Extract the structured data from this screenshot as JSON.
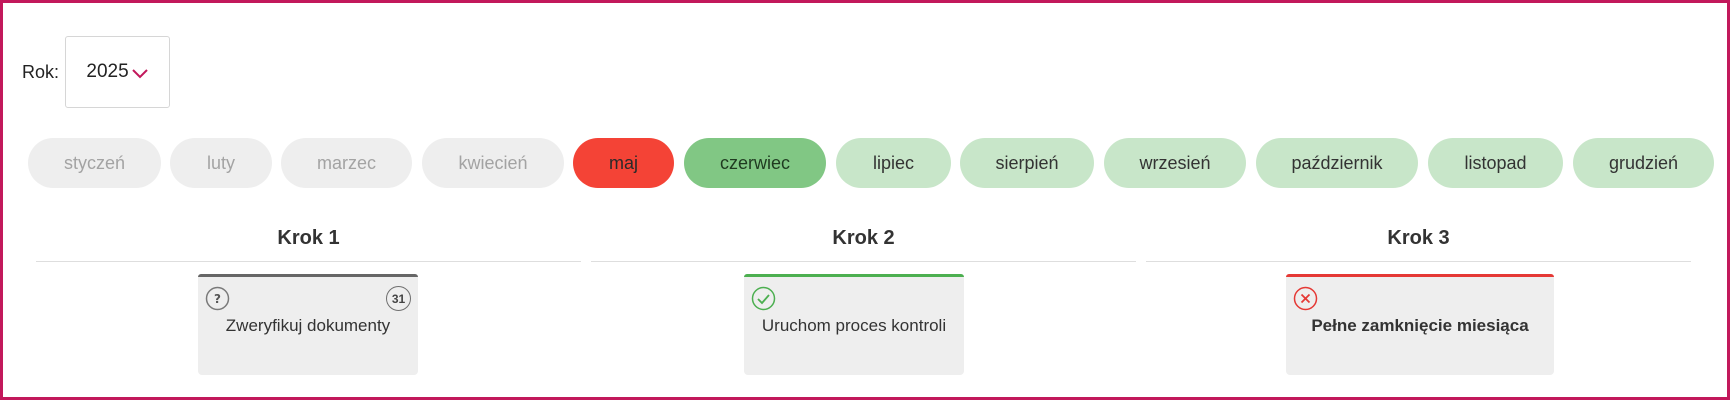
{
  "year_selector": {
    "label": "Rok:",
    "value": "2025",
    "icon": "chevron-down-icon",
    "icon_color": "#c2185b"
  },
  "months": [
    {
      "label": "styczeń",
      "status": "disabled"
    },
    {
      "label": "luty",
      "status": "disabled"
    },
    {
      "label": "marzec",
      "status": "disabled"
    },
    {
      "label": "kwiecień",
      "status": "disabled"
    },
    {
      "label": "maj",
      "status": "error"
    },
    {
      "label": "czerwiec",
      "status": "current"
    },
    {
      "label": "lipiec",
      "status": "future"
    },
    {
      "label": "sierpień",
      "status": "future"
    },
    {
      "label": "wrzesień",
      "status": "future"
    },
    {
      "label": "październik",
      "status": "future"
    },
    {
      "label": "listopad",
      "status": "future"
    },
    {
      "label": "grudzień",
      "status": "future"
    }
  ],
  "steps": [
    {
      "title": "Krok 1",
      "card": {
        "text": "Zweryfikuj dokumenty",
        "status": "unknown",
        "status_icon": "question-icon",
        "accent_color": "#666666",
        "count": "31"
      }
    },
    {
      "title": "Krok 2",
      "card": {
        "text": "Uruchom proces kontroli",
        "status": "done",
        "status_icon": "check-icon",
        "accent_color": "#4caf50"
      }
    },
    {
      "title": "Krok 3",
      "card": {
        "text": "Pełne zamknięcie miesiąca",
        "status": "failed",
        "status_icon": "cross-icon",
        "accent_color": "#e53935"
      }
    }
  ],
  "colors": {
    "frame_border": "#c2185b",
    "month_disabled": "#eeeeee",
    "month_error": "#f44336",
    "month_current": "#81c784",
    "month_future": "#c8e6c9"
  }
}
